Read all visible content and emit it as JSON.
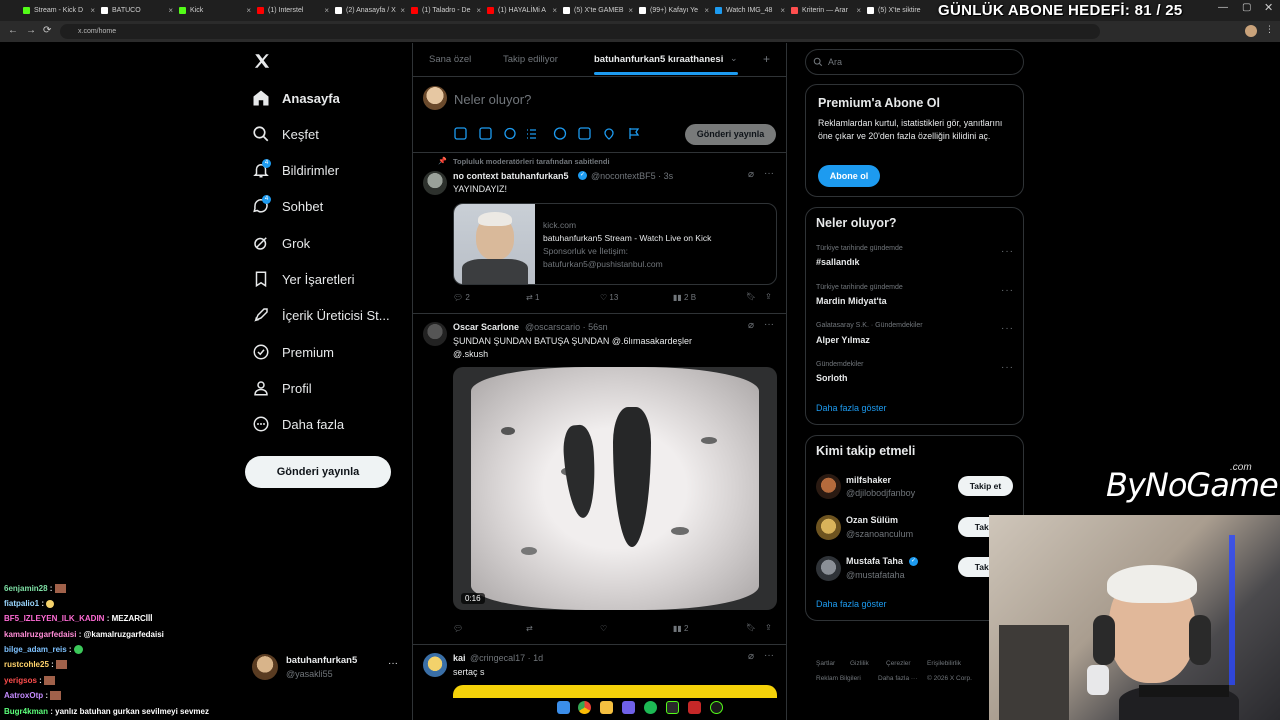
{
  "browser": {
    "tabs": [
      {
        "label": "Stream - Kick D",
        "color": "#53fc18"
      },
      {
        "label": "BATUCO",
        "color": "#ffffff"
      },
      {
        "label": "Kick",
        "color": "#53fc18"
      },
      {
        "label": "(1) Interstel",
        "color": "#ff0000"
      },
      {
        "label": "(2) Anasayfa / X",
        "color": "#ffffff"
      },
      {
        "label": "(1) Taladro - De",
        "color": "#ff0000"
      },
      {
        "label": "(1) HAYALİMi A",
        "color": "#ff0000"
      },
      {
        "label": "(5) X'te GAMEB",
        "color": "#ffffff"
      },
      {
        "label": "(99+) Kafayı Ye",
        "color": "#ffffff"
      },
      {
        "label": "Watch IMG_48",
        "color": "#1d9bf0"
      },
      {
        "label": "Kriterin — Arar",
        "color": "#ff4f4f"
      },
      {
        "label": "(5) X'te siktire",
        "color": "#ffffff"
      }
    ],
    "url": "x.com/home",
    "nav_back": "←",
    "nav_forward": "→",
    "nav_reload": "⟳"
  },
  "overlay": {
    "goal_text": "GÜNLÜK ABONE HEDEFİ: 81 / 25",
    "brand_logo": "ByNoGame",
    "brand_logo_suffix": ".com"
  },
  "sidebar": {
    "items": [
      {
        "label": "Anasayfa",
        "icon": "home-icon"
      },
      {
        "label": "Keşfet",
        "icon": "search-icon"
      },
      {
        "label": "Bildirimler",
        "icon": "bell-icon",
        "badge": "4"
      },
      {
        "label": "Sohbet",
        "icon": "chat-icon",
        "badge": "4"
      },
      {
        "label": "Grok",
        "icon": "grok-icon"
      },
      {
        "label": "Yer İşaretleri",
        "icon": "bookmark-icon"
      },
      {
        "label": "İçerik Üreticisi St...",
        "icon": "rocket-icon"
      },
      {
        "label": "Premium",
        "icon": "verified-icon"
      },
      {
        "label": "Profil",
        "icon": "person-icon"
      },
      {
        "label": "Daha fazla",
        "icon": "more-circle-icon"
      }
    ],
    "post_button": "Gönderi yayınla",
    "account": {
      "name": "batuhanfurkan5",
      "handle": "@yasakli55"
    }
  },
  "center": {
    "tabs": [
      "Sana özel",
      "Takip ediliyor",
      "batuhanfurkan5 kıraathanesi"
    ],
    "compose_placeholder": "Neler oluyor?",
    "compose_button": "Gönderi yayınla",
    "pinned_label": "Topluluk moderatörleri tarafından sabitlendi",
    "tweets": [
      {
        "name": "no context batuhanfurkan5",
        "handle": "@nocontextBF5",
        "time": "3s",
        "text": "YAYINDAYIZ!",
        "link_card": {
          "domain": "kick.com",
          "title": "batuhanfurkan5 Stream - Watch Live on Kick",
          "desc1": "Sponsorluk ve İletişim:",
          "desc2": "batufurkan5@pushistanbul.com"
        },
        "replies": "2",
        "reposts": "1",
        "likes": "13",
        "views": "2 B"
      },
      {
        "name": "Oscar Scarlone",
        "handle": "@oscarscario",
        "time": "56sn",
        "text1": "ŞUNDAN ŞUNDAN BATUŞA ŞUNDAN @.6lımasakardeşler",
        "text2": "@.skush",
        "video_time": "0:16",
        "replies": "",
        "reposts": "",
        "likes": "",
        "views": "2"
      },
      {
        "name": "kai",
        "handle": "@cringecal17",
        "time": "1d",
        "text": "sertaç s"
      }
    ]
  },
  "right": {
    "search_placeholder": "Ara",
    "premium": {
      "title": "Premium'a Abone Ol",
      "body": "Reklamlardan kurtul, istatistikleri gör, yanıtlarını öne çıkar ve 20'den fazla özelliğin kilidini aç.",
      "button": "Abone ol"
    },
    "trends_title": "Neler oluyor?",
    "trends": [
      {
        "category": "Türkiye tarihinde gündemde",
        "name": "#sallandık"
      },
      {
        "category": "Türkiye tarihinde gündemde",
        "name": "Mardin Midyat'ta"
      },
      {
        "category": "Galatasaray S.K. · Gündemdekiler",
        "name": "Alper Yılmaz"
      },
      {
        "category": "Gündemdekiler",
        "name": "Sorloth"
      }
    ],
    "trends_more": "Daha fazla göster",
    "follow_title": "Kimi takip etmeli",
    "follow": [
      {
        "name": "milfshaker",
        "handle": "@djilobodjfanboy",
        "button": "Takip et"
      },
      {
        "name": "Ozan Sülüm",
        "handle": "@szanoanculum",
        "button": "Takip"
      },
      {
        "name": "Mustafa Taha",
        "handle": "@mustafataha",
        "button": "Takip"
      }
    ],
    "follow_more": "Daha fazla göster",
    "footer": [
      "Şartlar",
      "Gizlilik",
      "Çerezler",
      "Erişilebilirlik",
      "Reklam Bilgileri",
      "Daha fazla ···",
      "© 2026 X Corp."
    ]
  },
  "chat": [
    {
      "user": "6enjamin28",
      "msg": "",
      "color": "#7ee0a5"
    },
    {
      "user": "fiatpalio1",
      "msg": "",
      "color": "#9ad7ff"
    },
    {
      "user": "BF5_IZLEYEN_ILK_KADIN",
      "msg": "MEZARCİİİ",
      "color": "#ff6bd5"
    },
    {
      "user": "kamalruzgarfedaisi",
      "msg": "@kamalruzgarfedaisi",
      "color": "#ff8cd6"
    },
    {
      "user": "bilge_adam_reis",
      "msg": "",
      "color": "#7ec2ff"
    },
    {
      "user": "rustcohle25",
      "msg": "",
      "color": "#ffd36b"
    },
    {
      "user": "yerigsos",
      "msg": "",
      "color": "#ff4d4d"
    },
    {
      "user": "AatroxOtp",
      "msg": "",
      "color": "#c58bff"
    },
    {
      "user": "Bugr4kman",
      "msg": "yanlız batuhan gurkan sevilmeyi sevmez",
      "color": "#5cff7a"
    }
  ]
}
